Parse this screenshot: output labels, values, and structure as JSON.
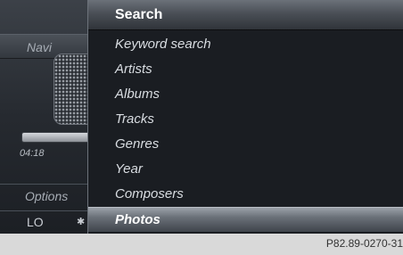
{
  "left_panel": {
    "navi_label": "Navi",
    "time": "04:18",
    "options_label": "Options",
    "lo_label": "LO"
  },
  "menu": {
    "header": "Search",
    "items": [
      {
        "label": "Keyword search"
      },
      {
        "label": "Artists"
      },
      {
        "label": "Albums"
      },
      {
        "label": "Tracks"
      },
      {
        "label": "Genres"
      },
      {
        "label": "Year"
      },
      {
        "label": "Composers"
      },
      {
        "label": "Photos"
      }
    ],
    "selected_index": 7
  },
  "caption": "P82.89-0270-31"
}
